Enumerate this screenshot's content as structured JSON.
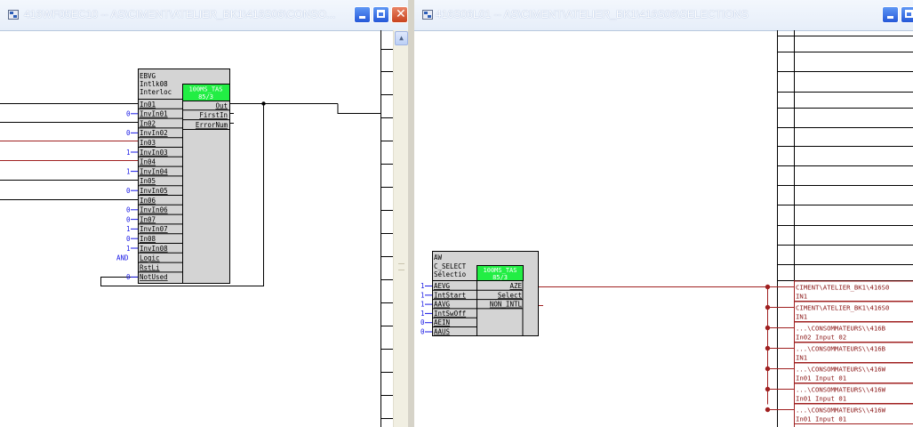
{
  "left_window": {
    "title": "416WF05EC10 -- AS\\CIMENT\\ATELIER_BK1\\416S06\\CONSO...",
    "block": {
      "type": "EBVG",
      "name": "Intlk08",
      "comment": "Interloc",
      "task_line1": "100MS_TAS",
      "task_line2": "85/3",
      "inputs": [
        {
          "label": "In01",
          "value": ""
        },
        {
          "label": "InvIn01",
          "value": "0"
        },
        {
          "label": "In02",
          "value": ""
        },
        {
          "label": "InvIn02",
          "value": "0"
        },
        {
          "label": "In03",
          "value": ""
        },
        {
          "label": "InvIn03",
          "value": "1"
        },
        {
          "label": "In04",
          "value": ""
        },
        {
          "label": "InvIn04",
          "value": "1"
        },
        {
          "label": "In05",
          "value": ""
        },
        {
          "label": "InvIn05",
          "value": "0"
        },
        {
          "label": "In06",
          "value": ""
        },
        {
          "label": "InvIn06",
          "value": "0"
        },
        {
          "label": "In07",
          "value": "0"
        },
        {
          "label": "InvIn07",
          "value": "1"
        },
        {
          "label": "In08",
          "value": "0"
        },
        {
          "label": "InvIn08",
          "value": "1"
        },
        {
          "label": "Logic",
          "value": "AND"
        },
        {
          "label": "RstLi",
          "value": ""
        },
        {
          "label": "NotUsed",
          "value": "0"
        }
      ],
      "outputs": [
        "Out",
        "FirstIn",
        "ErrorNum"
      ]
    }
  },
  "right_window": {
    "title": "416S06L01 -- AS\\CIMENT\\ATELIER_BK1\\416S06\\SELECTIONS",
    "block": {
      "type": "AW",
      "name": "C_SELECT",
      "comment": "Sélectio",
      "task_line1": "100MS_TAS",
      "task_line2": "85/3",
      "inputs": [
        {
          "label": "AEVG",
          "value": "1"
        },
        {
          "label": "IntStart",
          "value": "1"
        },
        {
          "label": "AAVG",
          "value": "1"
        },
        {
          "label": "IntSwOff",
          "value": "1"
        },
        {
          "label": "AEIN",
          "value": "0"
        },
        {
          "label": "AAUS",
          "value": "0"
        }
      ],
      "outputs": [
        "AZE",
        "Select",
        "NON_INTL"
      ]
    },
    "references": [
      {
        "line1": "CIMENT\\ATELIER_BK1\\416S0",
        "line2": "IN1"
      },
      {
        "line1": "CIMENT\\ATELIER_BK1\\416S0",
        "line2": "IN1"
      },
      {
        "line1": "...\\CONSOMMATEURS\\\\416B",
        "line2": "In02 Input 02"
      },
      {
        "line1": "...\\CONSOMMATEURS\\\\416B",
        "line2": "IN1"
      },
      {
        "line1": "...\\CONSOMMATEURS\\\\416W",
        "line2": "In01 Input 01"
      },
      {
        "line1": "...\\CONSOMMATEURS\\\\416W",
        "line2": "In01 Input 01"
      },
      {
        "line1": "...\\CONSOMMATEURS\\\\416W",
        "line2": "In01 Input 01"
      }
    ]
  },
  "colors": {
    "titlebar_text": "#ffffff",
    "block_fill": "#d4d4d4",
    "task_fill": "#22ee44",
    "constant_blue": "#1a1ae6",
    "wire_red": "#a02020",
    "reference_text": "#8a1515"
  }
}
